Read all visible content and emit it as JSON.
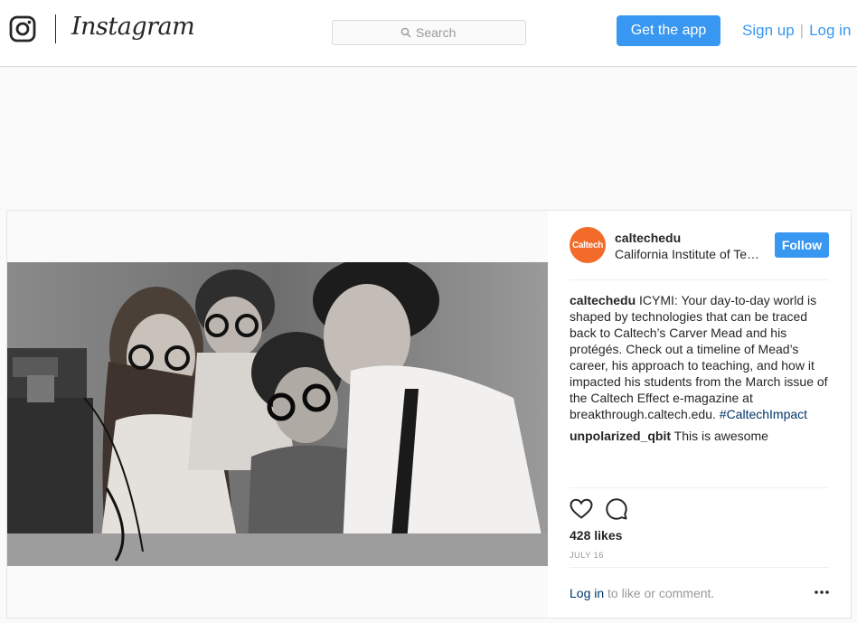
{
  "header": {
    "brand": "Instagram",
    "search_placeholder": "Search",
    "get_app_label": "Get the app",
    "signup_label": "Sign up",
    "separator": "|",
    "login_label": "Log in"
  },
  "post": {
    "account": {
      "avatar_text": "Caltech",
      "username": "caltechedu",
      "location": "California Institute of Technology",
      "follow_label": "Follow"
    },
    "caption": {
      "username": "caltechedu",
      "text": "ICYMI: Your day-to-day world is shaped by technologies that can be traced back to Caltech’s Carver Mead and his protégés. Check out a timeline of Mead’s career, his approach to teaching, and how it impacted his students from the March issue of the Caltech Effect e-magazine at breakthrough.caltech.edu.",
      "hashtag": "#CaltechImpact"
    },
    "comment": {
      "username": "unpolarized_qbit",
      "text": "This is awesome"
    },
    "likes": "428 likes",
    "date": "JULY 16",
    "login_prompt": {
      "link": "Log in",
      "text": "to like or comment."
    }
  },
  "colors": {
    "accent": "#3897f0",
    "avatar": "#f26b29",
    "border": "#dbdbdb",
    "muted": "#999999"
  },
  "icons": [
    "instagram-glyph-icon",
    "search-icon",
    "heart-icon",
    "comment-icon",
    "more-options-icon"
  ]
}
